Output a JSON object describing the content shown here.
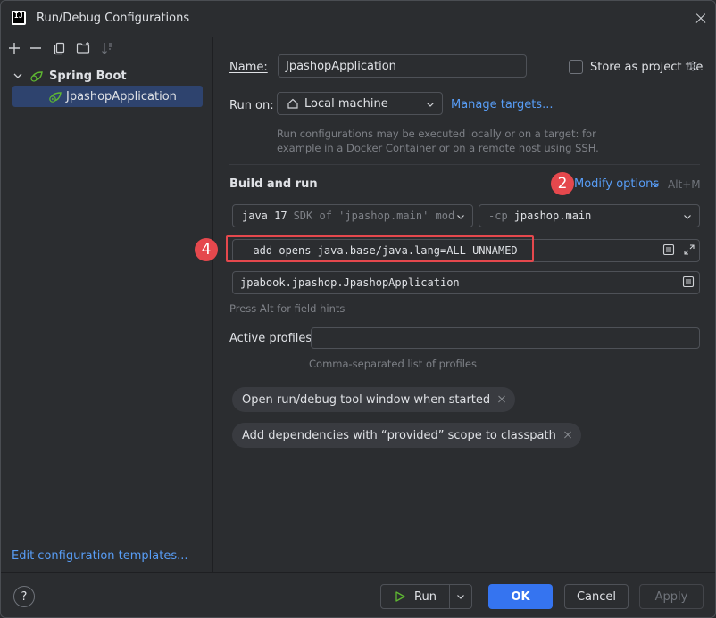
{
  "window": {
    "title": "Run/Debug Configurations",
    "app_logo_text": "IJ"
  },
  "sidebar": {
    "group_label": "Spring Boot",
    "item_label": "JpashopApplication",
    "edit_templates_link": "Edit configuration templates..."
  },
  "form": {
    "name_label": "Name:",
    "name_value": "JpashopApplication",
    "store_label": "Store as project file",
    "store_checked": false,
    "run_on_label": "Run on:",
    "run_on_value": "Local machine",
    "manage_targets_link": "Manage targets...",
    "run_on_hint_line1": "Run configurations may be executed locally or on a target: for",
    "run_on_hint_line2": "example in a Docker Container or on a remote host using SSH.",
    "build_and_run_title": "Build and run",
    "modify_options_link": "Modify options",
    "modify_options_shortcut": "Alt+M",
    "jdk_name": "java 17",
    "jdk_detail": "SDK of 'jpashop.main' mod",
    "classpath_flag": "-cp",
    "classpath_value": "jpashop.main",
    "vm_options_value": "--add-opens java.base/java.lang=ALL-UNNAMED",
    "main_class_value": "jpabook.jpashop.JpashopApplication",
    "field_hint": "Press Alt for field hints",
    "active_profiles_label": "Active profiles:",
    "active_profiles_value": "",
    "active_profiles_hint": "Comma-separated list of profiles",
    "chip_1": "Open run/debug tool window when started",
    "chip_2": "Add dependencies with “provided” scope to classpath"
  },
  "annotations": {
    "badge_modify": "2",
    "badge_vm": "4",
    "color": "#e5484d"
  },
  "buttons": {
    "help": "?",
    "run": "Run",
    "ok": "OK",
    "cancel": "Cancel",
    "apply": "Apply"
  },
  "colors": {
    "accent": "#3574f0",
    "link": "#589df6",
    "background": "#2b2d30",
    "selection": "#2e436e"
  }
}
